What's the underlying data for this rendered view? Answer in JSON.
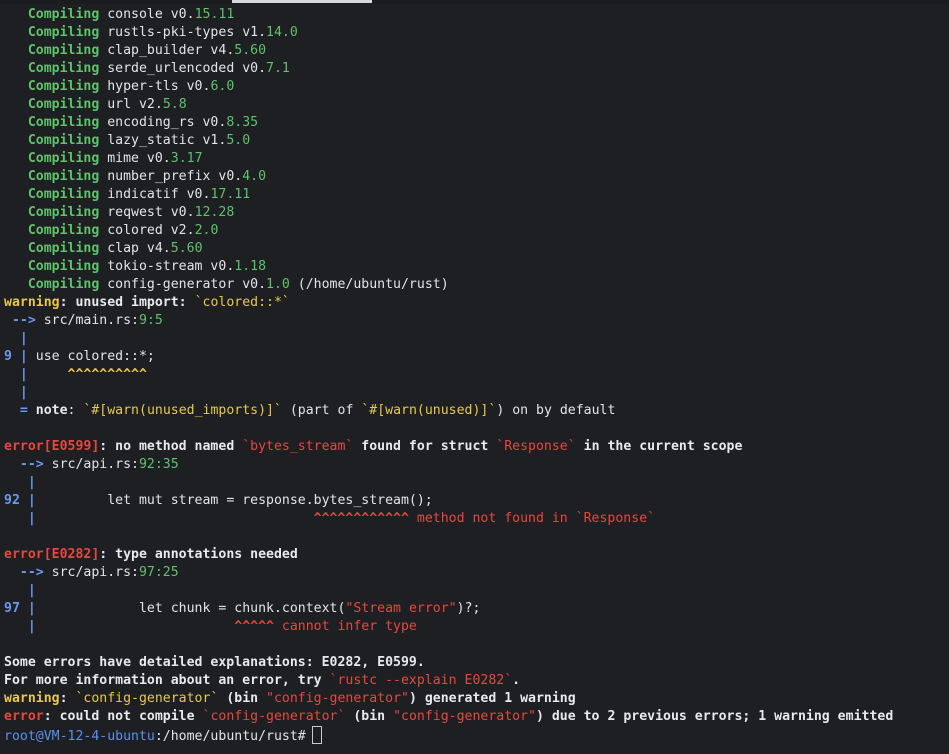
{
  "terminal": {
    "lines": [
      [
        [
          "c-green",
          "   Compiling"
        ],
        [
          "c-white",
          " console v0."
        ],
        [
          "c-num",
          "15.11"
        ]
      ],
      [
        [
          "c-green",
          "   Compiling"
        ],
        [
          "c-white",
          " rustls-pki-types v1."
        ],
        [
          "c-num",
          "14.0"
        ]
      ],
      [
        [
          "c-green",
          "   Compiling"
        ],
        [
          "c-white",
          " clap_builder v4."
        ],
        [
          "c-num",
          "5.60"
        ]
      ],
      [
        [
          "c-green",
          "   Compiling"
        ],
        [
          "c-white",
          " serde_urlencoded v0."
        ],
        [
          "c-num",
          "7.1"
        ]
      ],
      [
        [
          "c-green",
          "   Compiling"
        ],
        [
          "c-white",
          " hyper-tls v0."
        ],
        [
          "c-num",
          "6.0"
        ]
      ],
      [
        [
          "c-green",
          "   Compiling"
        ],
        [
          "c-white",
          " url v2."
        ],
        [
          "c-num",
          "5.8"
        ]
      ],
      [
        [
          "c-green",
          "   Compiling"
        ],
        [
          "c-white",
          " encoding_rs v0."
        ],
        [
          "c-num",
          "8.35"
        ]
      ],
      [
        [
          "c-green",
          "   Compiling"
        ],
        [
          "c-white",
          " lazy_static v1."
        ],
        [
          "c-num",
          "5.0"
        ]
      ],
      [
        [
          "c-green",
          "   Compiling"
        ],
        [
          "c-white",
          " mime v0."
        ],
        [
          "c-num",
          "3.17"
        ]
      ],
      [
        [
          "c-green",
          "   Compiling"
        ],
        [
          "c-white",
          " number_prefix v0."
        ],
        [
          "c-num",
          "4.0"
        ]
      ],
      [
        [
          "c-green",
          "   Compiling"
        ],
        [
          "c-white",
          " indicatif v0."
        ],
        [
          "c-num",
          "17.11"
        ]
      ],
      [
        [
          "c-green",
          "   Compiling"
        ],
        [
          "c-white",
          " reqwest v0."
        ],
        [
          "c-num",
          "12.28"
        ]
      ],
      [
        [
          "c-green",
          "   Compiling"
        ],
        [
          "c-white",
          " colored v2."
        ],
        [
          "c-num",
          "2.0"
        ]
      ],
      [
        [
          "c-green",
          "   Compiling"
        ],
        [
          "c-white",
          " clap v4."
        ],
        [
          "c-num",
          "5.60"
        ]
      ],
      [
        [
          "c-green",
          "   Compiling"
        ],
        [
          "c-white",
          " tokio-stream v0."
        ],
        [
          "c-num",
          "1.18"
        ]
      ],
      [
        [
          "c-green",
          "   Compiling"
        ],
        [
          "c-white",
          " config-generator v0."
        ],
        [
          "c-num",
          "1.0"
        ],
        [
          "c-white",
          " (/home/ubuntu/rust)"
        ]
      ],
      [
        [
          "c-yellow",
          "warning"
        ],
        [
          "c-whiteb",
          ": unused import: "
        ],
        [
          "c-yellown",
          "`colored::*`"
        ]
      ],
      [
        [
          "c-blueb",
          " --> "
        ],
        [
          "c-white",
          "src/main.rs:"
        ],
        [
          "c-num",
          "9:5"
        ]
      ],
      [
        [
          "c-blueb",
          "  |"
        ]
      ],
      [
        [
          "c-blueb",
          "9 |"
        ],
        [
          "c-white",
          " use colored::*;"
        ]
      ],
      [
        [
          "c-blueb",
          "  |"
        ],
        [
          "c-yellow",
          "     ^^^^^^^^^^"
        ]
      ],
      [
        [
          "c-blueb",
          "  |"
        ]
      ],
      [
        [
          "c-blueb",
          "  = "
        ],
        [
          "c-whiteb",
          "note"
        ],
        [
          "c-white",
          ": "
        ],
        [
          "c-yellown",
          "`#[warn(unused_imports)]`"
        ],
        [
          "c-white",
          " (part of "
        ],
        [
          "c-yellown",
          "`#[warn(unused)]`"
        ],
        [
          "c-white",
          ") on by default"
        ]
      ],
      [],
      [
        [
          "c-red",
          "error[E0599]"
        ],
        [
          "c-whiteb",
          ": no method named "
        ],
        [
          "c-redn",
          "`bytes_stream`"
        ],
        [
          "c-whiteb",
          " found for struct "
        ],
        [
          "c-redn",
          "`Response`"
        ],
        [
          "c-whiteb",
          " in the current scope"
        ]
      ],
      [
        [
          "c-blueb",
          "  --> "
        ],
        [
          "c-white",
          "src/api.rs:"
        ],
        [
          "c-num",
          "92:35"
        ]
      ],
      [
        [
          "c-blueb",
          "   |"
        ]
      ],
      [
        [
          "c-blueb",
          "92 |"
        ],
        [
          "c-white",
          "         let mut stream = response.bytes_stream();"
        ]
      ],
      [
        [
          "c-blueb",
          "   |"
        ],
        [
          "c-red",
          "                                   ^^^^^^^^^^^^"
        ],
        [
          "c-redtxt",
          " method not found in "
        ],
        [
          "c-redn",
          "`Response`"
        ]
      ],
      [],
      [
        [
          "c-red",
          "error[E0282]"
        ],
        [
          "c-whiteb",
          ": type annotations needed"
        ]
      ],
      [
        [
          "c-blueb",
          "  --> "
        ],
        [
          "c-white",
          "src/api.rs:"
        ],
        [
          "c-num",
          "97:25"
        ]
      ],
      [
        [
          "c-blueb",
          "   |"
        ]
      ],
      [
        [
          "c-blueb",
          "97 |"
        ],
        [
          "c-white",
          "             let chunk = chunk.context("
        ],
        [
          "c-redn",
          "\"Stream error\""
        ],
        [
          "c-white",
          ")?;"
        ]
      ],
      [
        [
          "c-blueb",
          "   |"
        ],
        [
          "c-red",
          "                         ^^^^^"
        ],
        [
          "c-redtxt",
          " cannot infer type"
        ]
      ],
      [],
      [
        [
          "c-whiteb",
          "Some errors have detailed explanations: E0282, E0599."
        ]
      ],
      [
        [
          "c-whiteb",
          "For more information about an error, try "
        ],
        [
          "c-redn",
          "`rustc --explain E0282`"
        ],
        [
          "c-whiteb",
          "."
        ]
      ],
      [
        [
          "c-yellow",
          "warning"
        ],
        [
          "c-whiteb",
          ": "
        ],
        [
          "c-yellown",
          "`config-generator`"
        ],
        [
          "c-whiteb",
          " (bin "
        ],
        [
          "c-redn",
          "\"config-generator\""
        ],
        [
          "c-whiteb",
          ") generated 1 warning"
        ]
      ],
      [
        [
          "c-red",
          "error"
        ],
        [
          "c-whiteb",
          ": could not compile "
        ],
        [
          "c-redn",
          "`config-generator`"
        ],
        [
          "c-whiteb",
          " (bin "
        ],
        [
          "c-redn",
          "\"config-generator\""
        ],
        [
          "c-whiteb",
          ") due to 2 previous errors; 1 warning emitted"
        ]
      ]
    ],
    "prompt": {
      "user_host": "root@VM-12-4-ubuntu",
      "path": ":/home/ubuntu/rust#"
    }
  }
}
